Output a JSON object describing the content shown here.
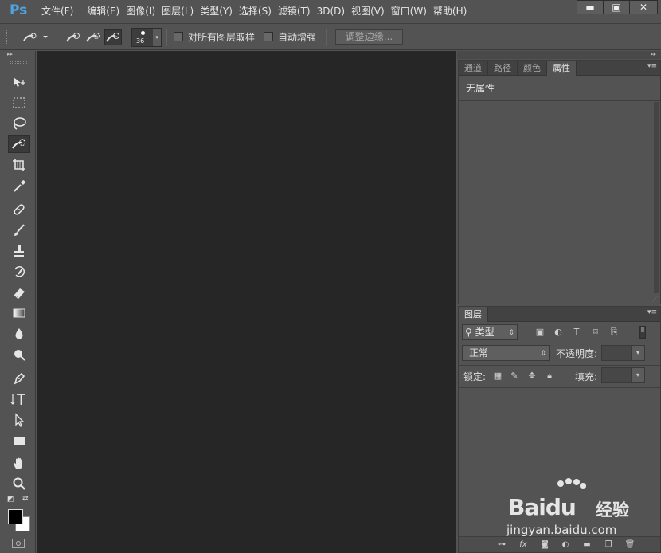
{
  "app": {
    "logo": "Ps"
  },
  "menu": [
    "文件(F)",
    "编辑(E)",
    "图像(I)",
    "图层(L)",
    "类型(Y)",
    "选择(S)",
    "滤镜(T)",
    "3D(D)",
    "视图(V)",
    "窗口(W)",
    "帮助(H)"
  ],
  "window_controls": {
    "minimize": "▬",
    "maximize": "▣",
    "close": "✕"
  },
  "options_bar": {
    "tool_preset_icon": "quick-selection-brush-icon",
    "brush_size": "36",
    "sample_all_layers_label": "对所有图层取样",
    "sample_all_layers_checked": false,
    "auto_enhance_label": "自动增强",
    "auto_enhance_checked": false,
    "refine_edge_label": "调整边缘..."
  },
  "toolbar": {
    "collapse_label": "▸▸",
    "tools": [
      {
        "name": "move-tool",
        "icon": "move-icon",
        "glyph": "➤"
      },
      {
        "name": "marquee-tool",
        "icon": "rect-marquee-icon",
        "glyph": "⬚"
      },
      {
        "name": "lasso-tool",
        "icon": "lasso-icon",
        "glyph": "ℓ"
      },
      {
        "name": "quick-selection-tool",
        "icon": "quick-selection-icon",
        "glyph": "✎",
        "active": true
      },
      {
        "name": "crop-tool",
        "icon": "crop-icon",
        "glyph": "⌗"
      },
      {
        "name": "eyedropper-tool",
        "icon": "eyedropper-icon",
        "glyph": "✒"
      },
      {
        "name": "healing-tool",
        "icon": "bandage-icon",
        "glyph": "✚"
      },
      {
        "name": "brush-tool",
        "icon": "brush-icon",
        "glyph": "/"
      },
      {
        "name": "stamp-tool",
        "icon": "stamp-icon",
        "glyph": "⊥"
      },
      {
        "name": "history-brush-tool",
        "icon": "history-brush-icon",
        "glyph": "↺"
      },
      {
        "name": "eraser-tool",
        "icon": "eraser-icon",
        "glyph": "▰"
      },
      {
        "name": "gradient-tool",
        "icon": "gradient-icon",
        "glyph": "▭"
      },
      {
        "name": "blur-tool",
        "icon": "drop-icon",
        "glyph": "●"
      },
      {
        "name": "dodge-tool",
        "icon": "dodge-icon",
        "glyph": "⚲"
      },
      {
        "name": "pen-tool",
        "icon": "pen-icon",
        "glyph": "✑"
      },
      {
        "name": "type-tool",
        "icon": "type-icon",
        "glyph": "↓T"
      },
      {
        "name": "path-selection-tool",
        "icon": "arrow-icon",
        "glyph": "↖"
      },
      {
        "name": "shape-tool",
        "icon": "rectangle-icon",
        "glyph": "■"
      },
      {
        "name": "hand-tool",
        "icon": "hand-icon",
        "glyph": "✋"
      },
      {
        "name": "zoom-tool",
        "icon": "zoom-icon",
        "glyph": "⚲"
      }
    ],
    "colors": {
      "foreground": "#000000",
      "background": "#ffffff"
    }
  },
  "properties_panel": {
    "tabs": [
      "通道",
      "路径",
      "颜色",
      "属性"
    ],
    "active_tab": "属性",
    "content": "无属性"
  },
  "layers_panel": {
    "tab": "图层",
    "filter_kind": "类型",
    "blend_mode": "正常",
    "opacity_label": "不透明度:",
    "lock_label": "锁定:",
    "fill_label": "填充:"
  },
  "watermark": {
    "brand": "Bai",
    "brand2": "du",
    "sub": "经验",
    "url": "jingyan.baidu.com"
  }
}
